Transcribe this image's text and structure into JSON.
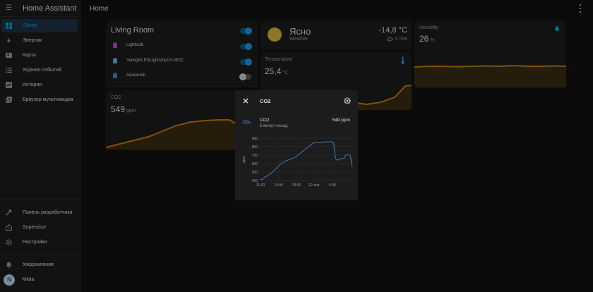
{
  "app": {
    "title": "Home Assistant",
    "page_title": "Home"
  },
  "sidebar": {
    "items": [
      {
        "label": "Обзор",
        "icon": "dashboard-icon",
        "active": true
      },
      {
        "label": "Энергия",
        "icon": "lightning-icon",
        "active": false
      },
      {
        "label": "Карта",
        "icon": "map-icon",
        "active": false
      },
      {
        "label": "Журнал событий",
        "icon": "logbook-icon",
        "active": false
      },
      {
        "label": "История",
        "icon": "history-chart-icon",
        "active": false
      },
      {
        "label": "Браузер мультимедиа",
        "icon": "media-icon",
        "active": false
      }
    ],
    "bottom_items": [
      {
        "label": "Панель разработчика",
        "icon": "hammer-icon"
      },
      {
        "label": "Supervisor",
        "icon": "home-assistant-icon"
      },
      {
        "label": "Настройки",
        "icon": "gear-icon"
      }
    ],
    "notifications_label": "Уведомления",
    "user": {
      "initial": "N",
      "name": "Nikita"
    }
  },
  "living_room": {
    "title": "Living Room",
    "entities": [
      {
        "name": "Lightbulb",
        "color": "#b14ed6",
        "on": true
      },
      {
        "name": "YeelightLEDLightstrip1S-0E2C",
        "color": "#4fc3e0",
        "on": true
      },
      {
        "name": "AqaraHub",
        "color": "#4a8ab0",
        "on": false
      }
    ]
  },
  "weather": {
    "condition": "Ясно",
    "label": "Weather",
    "temperature": "-14,8 °C",
    "precipitation": "0 mm"
  },
  "humidity": {
    "label": "Humidity",
    "value": "26",
    "unit": "%"
  },
  "temperature": {
    "label": "Temperature",
    "value": "25,4",
    "unit": "°C"
  },
  "co2_card": {
    "label": "CO2",
    "value": "549",
    "unit": "ppm"
  },
  "dialog": {
    "title": "CO2",
    "entity_icon": "molecule-co2-icon",
    "entity_name": "CO2",
    "entity_time": "5 минут назад",
    "entity_value": "549 ppm"
  },
  "colors": {
    "accent": "#03a9f4",
    "graph": "#c27e13",
    "graph_fill": "#3b2b11",
    "chart_line": "#4d8fd1"
  },
  "chart_data": {
    "type": "line",
    "title": "",
    "xlabel": "",
    "ylabel": "ppm",
    "x_ticks": [
      "11:00",
      "15:00",
      "20:00",
      "12 янв.",
      "6:00"
    ],
    "y_ticks": [
      400,
      500,
      600,
      700,
      800,
      900
    ],
    "ylim": [
      400,
      900
    ],
    "grid": true,
    "series": [
      {
        "values": [
          410,
          415,
          440,
          450,
          470,
          480,
          510,
          530,
          555,
          580,
          600,
          620,
          630,
          640,
          650,
          660,
          670,
          680,
          700,
          720,
          740,
          760,
          780,
          800,
          820,
          840,
          850,
          850,
          850,
          845,
          850,
          855,
          860,
          855,
          860,
          850,
          660,
          640,
          650,
          660,
          660,
          700,
          705,
          700,
          560
        ]
      }
    ]
  }
}
